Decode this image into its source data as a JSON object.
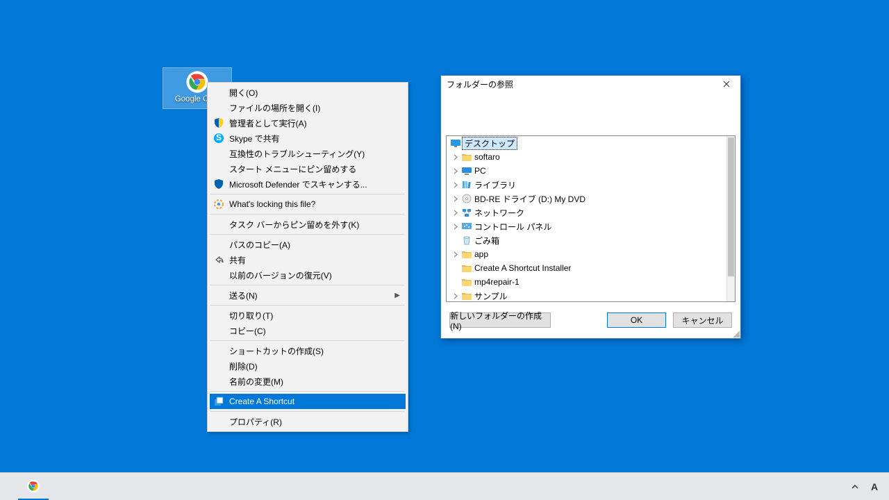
{
  "desktop": {
    "icon_label": "Google Ch..."
  },
  "context_menu": {
    "open": "開く(O)",
    "open_file_location": "ファイルの場所を開く(I)",
    "run_as_admin": "管理者として実行(A)",
    "skype_share": "Skype で共有",
    "troubleshoot": "互換性のトラブルシューティング(Y)",
    "pin_start": "スタート メニューにピン留めする",
    "defender_scan": "Microsoft Defender でスキャンする...",
    "whats_locking": "What's locking this file?",
    "unpin_taskbar": "タスク バーからピン留めを外す(K)",
    "copy_path": "パスのコピー(A)",
    "share": "共有",
    "restore_prev": "以前のバージョンの復元(V)",
    "send_to": "送る(N)",
    "cut": "切り取り(T)",
    "copy": "コピー(C)",
    "create_shortcut_sys": "ショートカットの作成(S)",
    "delete": "削除(D)",
    "rename": "名前の変更(M)",
    "create_a_shortcut": "Create A Shortcut",
    "properties": "プロパティ(R)"
  },
  "dialog": {
    "title": "フォルダーの参照",
    "buttons": {
      "new_folder": "新しいフォルダーの作成(N)",
      "ok": "OK",
      "cancel": "キャンセル"
    },
    "tree": {
      "desktop": "デスクトップ",
      "items": [
        {
          "label": "softaro",
          "icon": "folder",
          "expandable": true
        },
        {
          "label": "PC",
          "icon": "pc",
          "expandable": true
        },
        {
          "label": "ライブラリ",
          "icon": "libraries",
          "expandable": true
        },
        {
          "label": "BD-RE ドライブ (D:) My DVD",
          "icon": "disc",
          "expandable": true
        },
        {
          "label": "ネットワーク",
          "icon": "network",
          "expandable": true
        },
        {
          "label": "コントロール パネル",
          "icon": "control",
          "expandable": true
        },
        {
          "label": "ごみ箱",
          "icon": "recycle",
          "expandable": false
        },
        {
          "label": "app",
          "icon": "folder",
          "expandable": true
        },
        {
          "label": "Create A Shortcut Installer",
          "icon": "folder",
          "expandable": false
        },
        {
          "label": "mp4repair-1",
          "icon": "folder",
          "expandable": false
        },
        {
          "label": "サンプル",
          "icon": "folder",
          "expandable": true
        }
      ]
    }
  }
}
